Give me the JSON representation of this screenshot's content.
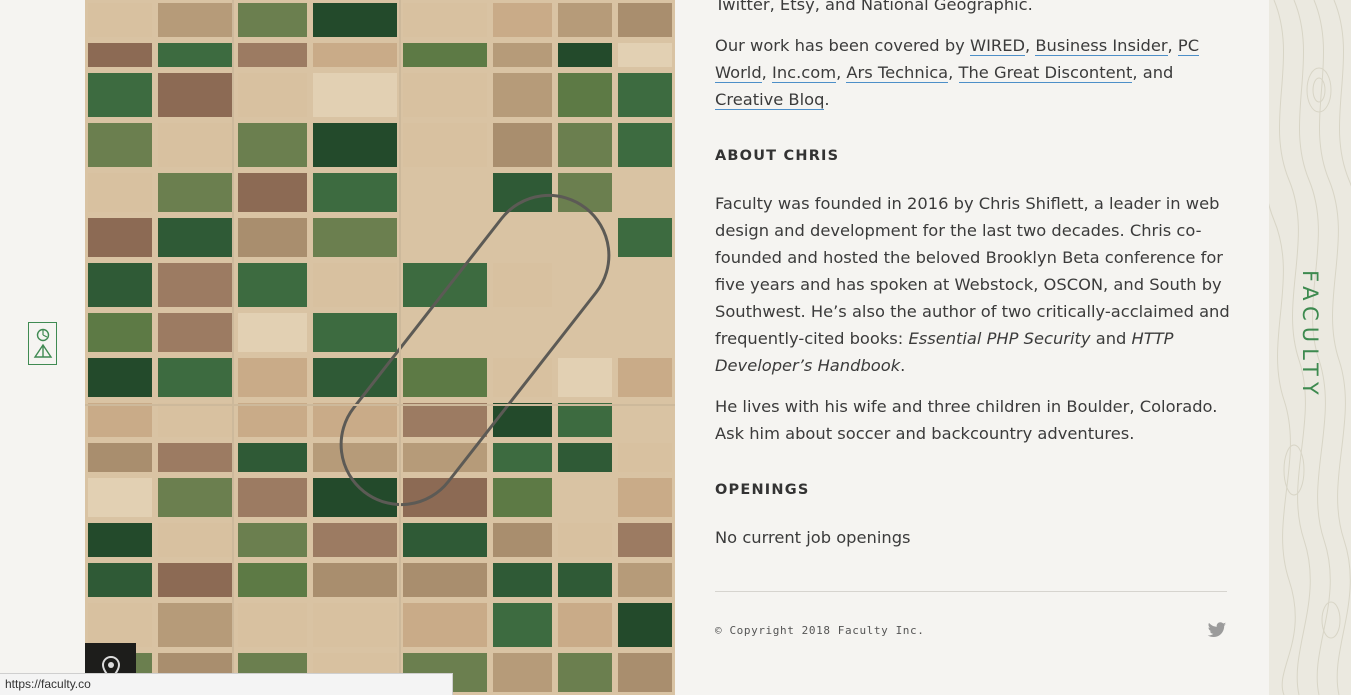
{
  "intro_tail": "Twitter, Etsy, and National Geographic.",
  "press": {
    "lead": "Our work has been covered by",
    "links": [
      "WIRED",
      "Business Insider",
      "PC World",
      "Inc.com",
      "Ars Technica",
      "The Great Discontent",
      "Creative Bloq"
    ],
    "and_word": "and"
  },
  "about": {
    "heading": "ABOUT CHRIS",
    "paragraph1_start": "Faculty was founded in 2016 by Chris Shiflett, a leader in web design and development for the last two decades. Chris co-founded and hosted the beloved Brooklyn Beta conference for five years and has spoken at Webstock, OSCON, and South by Southwest. He’s also the author of two critically-acclaimed and frequently-cited books:",
    "book1": "Essential PHP Security",
    "book_joiner": "and",
    "book2": "HTTP Developer’s Handbook",
    "paragraph2": "He lives with his wife and three children in Boulder, Colorado. Ask him about soccer and backcountry adventures."
  },
  "openings": {
    "heading": "OPENINGS",
    "text": "No current job openings"
  },
  "footer": {
    "copyright": "© Copyright 2018 Faculty Inc.",
    "twitter_icon": "twitter-icon"
  },
  "brand": {
    "name": "FACULTY"
  },
  "status_url": "https://faculty.co",
  "colors": {
    "accent_green": "#3d8a4f",
    "link_underline": "#4d8fc8",
    "background": "#f5f4f1"
  }
}
